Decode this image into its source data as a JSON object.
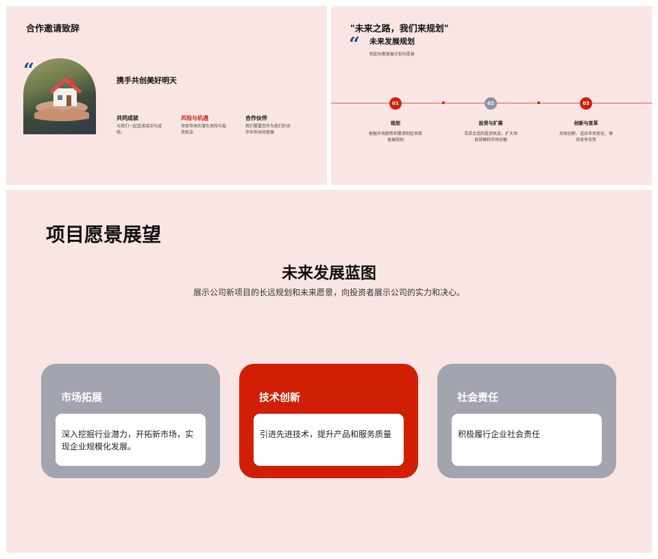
{
  "slide1": {
    "title": "合作邀请致辞",
    "quote_mark": "“",
    "heading": "携手共创美好明天",
    "columns": [
      {
        "title": "共同成就",
        "desc": "与我们一起追求成功与成就。",
        "accent": false
      },
      {
        "title": "风险与机遇",
        "desc": "项目带来的潜在风险与投资机会",
        "accent": true
      },
      {
        "title": "合作伙伴",
        "desc": "我们需要您作为我们的合作伙伴共同发展",
        "accent": false
      }
    ]
  },
  "slide2": {
    "title": "\"未来之路，我们来规划\"",
    "quote_mark": "“",
    "subtitle": "未来发展规划",
    "subdesc": "制定长期发展计划与愿景",
    "steps": [
      {
        "num": "01",
        "title": "规划",
        "desc": "根据市场趋势和需求制定项目发展规划",
        "color": "#d11f10"
      },
      {
        "num": "02",
        "title": "投资与扩展",
        "desc": "寻求合适的投资机会，扩大项目规模和市场份额",
        "color": "#8a94a6"
      },
      {
        "num": "03",
        "title": "创新与变革",
        "desc": "持续创新，适应市场变化，保持竞争优势",
        "color": "#d11f10"
      }
    ]
  },
  "slide3": {
    "title": "项目愿景展望",
    "heading": "未来发展蓝图",
    "desc": "展示公司新项目的长远规划和未来愿景，向投资者展示公司的实力和决心。",
    "cards": [
      {
        "title": "市场拓展",
        "desc": "深入挖掘行业潜力，开拓新市场，实现企业规模化发展。",
        "color": "#a2a5b0"
      },
      {
        "title": "技术创新",
        "desc": "引进先进技术，提升产品和服务质量",
        "color": "#d11f05"
      },
      {
        "title": "社会责任",
        "desc": "积极履行企业社会责任",
        "color": "#a2a5b0"
      }
    ]
  },
  "colors": {
    "accent_red": "#d11f10",
    "slide_bg": "#f9e6e4",
    "quote_blue": "#1f4e8c"
  }
}
